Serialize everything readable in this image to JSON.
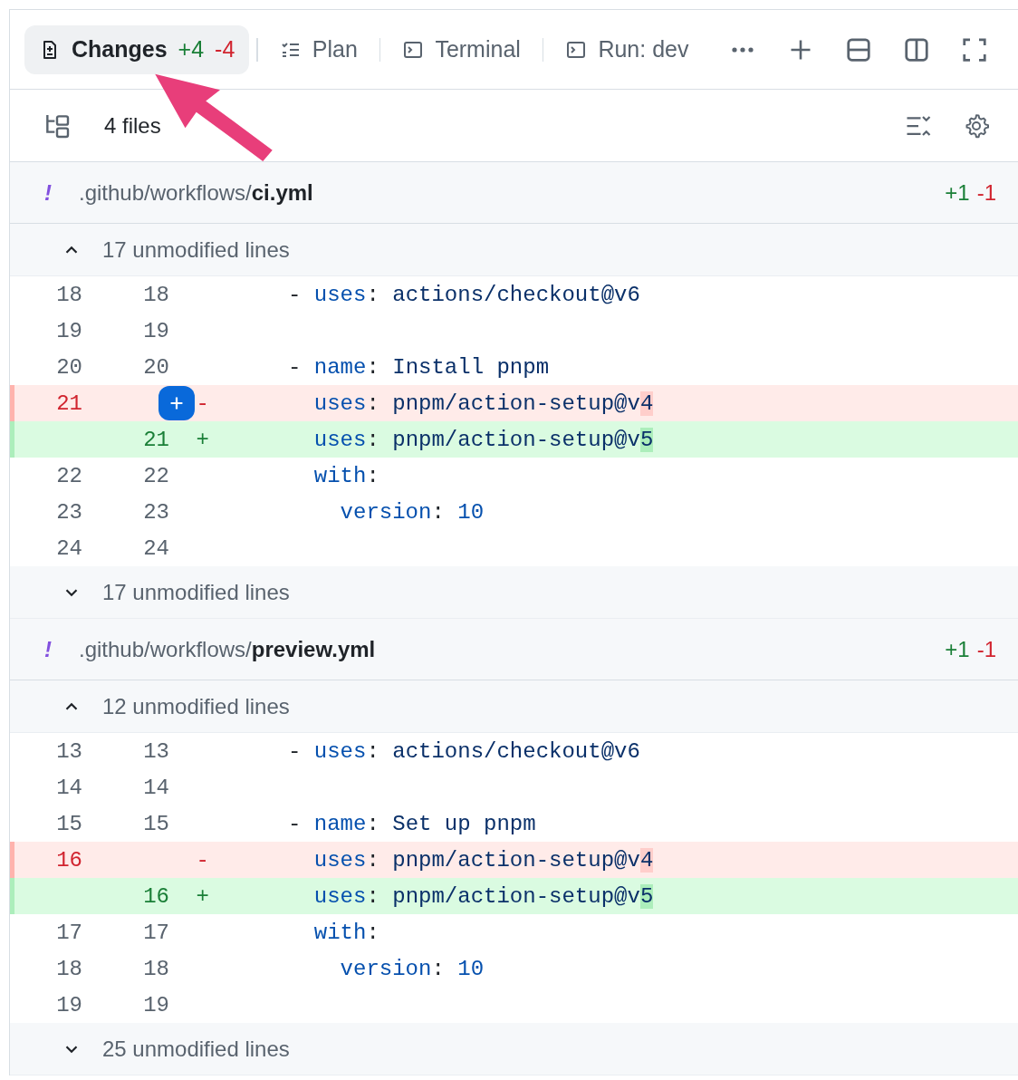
{
  "tabs": [
    {
      "kind": "changes",
      "label": "Changes",
      "added": "+4",
      "removed": "-4",
      "selected": true
    },
    {
      "kind": "plan",
      "label": "Plan",
      "selected": false
    },
    {
      "kind": "terminal",
      "label": "Terminal",
      "selected": false
    },
    {
      "kind": "terminal",
      "label": "Run: dev",
      "selected": false
    }
  ],
  "toolbar": {
    "file_count": "4 files"
  },
  "files": [
    {
      "marker": "!",
      "directory": ".github/workflows/",
      "filename": "ci.yml",
      "added": "+1",
      "removed": "-1",
      "sections": [
        {
          "kind": "collapsed",
          "expanded": false,
          "label": "17 unmodified lines"
        },
        {
          "kind": "lines",
          "lines": [
            {
              "kind": "context",
              "old": "18",
              "new": "18",
              "hover": false,
              "tokens": [
                {
                  "text": "- ",
                  "kind": "punct"
                },
                {
                  "text": "uses",
                  "kind": "key"
                },
                {
                  "text": ": ",
                  "kind": "punct"
                },
                {
                  "text": "actions/checkout@v6",
                  "kind": "value"
                }
              ]
            },
            {
              "kind": "context",
              "old": "19",
              "new": "19",
              "hover": false
            },
            {
              "kind": "context",
              "old": "20",
              "new": "20",
              "hover": false,
              "tokens": [
                {
                  "text": "- ",
                  "kind": "punct"
                },
                {
                  "text": "name",
                  "kind": "key"
                },
                {
                  "text": ": ",
                  "kind": "punct"
                },
                {
                  "text": "Install pnpm",
                  "kind": "value"
                }
              ]
            },
            {
              "kind": "removed",
              "old": "21",
              "sign": "-",
              "hover": true,
              "tokens": [
                {
                  "text": "  uses",
                  "kind": "key"
                },
                {
                  "text": ": ",
                  "kind": "punct"
                },
                {
                  "text": "pnpm/action-setup@v",
                  "kind": "value"
                },
                {
                  "text": "4",
                  "kind": "changed"
                }
              ]
            },
            {
              "kind": "added",
              "new": "21",
              "sign": "+",
              "hover": false,
              "tokens": [
                {
                  "text": "  uses",
                  "kind": "key"
                },
                {
                  "text": ": ",
                  "kind": "punct"
                },
                {
                  "text": "pnpm/action-setup@v",
                  "kind": "value"
                },
                {
                  "text": "5",
                  "kind": "changed"
                }
              ]
            },
            {
              "kind": "context",
              "old": "22",
              "new": "22",
              "hover": false,
              "tokens": [
                {
                  "text": "  with",
                  "kind": "key"
                },
                {
                  "text": ":",
                  "kind": "punct"
                }
              ]
            },
            {
              "kind": "context",
              "old": "23",
              "new": "23",
              "hover": false,
              "tokens": [
                {
                  "text": "    version",
                  "kind": "key"
                },
                {
                  "text": ": ",
                  "kind": "punct"
                },
                {
                  "text": "10",
                  "kind": "number"
                }
              ]
            },
            {
              "kind": "context",
              "old": "24",
              "new": "24",
              "hover": false
            }
          ]
        },
        {
          "kind": "collapsed",
          "expanded": false,
          "label": "17 unmodified lines"
        }
      ]
    },
    {
      "marker": "!",
      "directory": ".github/workflows/",
      "filename": "preview.yml",
      "added": "+1",
      "removed": "-1",
      "sections": [
        {
          "kind": "collapsed",
          "expanded": false,
          "label": "12 unmodified lines"
        },
        {
          "kind": "lines",
          "lines": [
            {
              "kind": "context",
              "old": "13",
              "new": "13",
              "hover": false,
              "tokens": [
                {
                  "text": "- ",
                  "kind": "punct"
                },
                {
                  "text": "uses",
                  "kind": "key"
                },
                {
                  "text": ": ",
                  "kind": "punct"
                },
                {
                  "text": "actions/checkout@v6",
                  "kind": "value"
                }
              ]
            },
            {
              "kind": "context",
              "old": "14",
              "new": "14",
              "hover": false
            },
            {
              "kind": "context",
              "old": "15",
              "new": "15",
              "hover": false,
              "tokens": [
                {
                  "text": "- ",
                  "kind": "punct"
                },
                {
                  "text": "name",
                  "kind": "key"
                },
                {
                  "text": ": ",
                  "kind": "punct"
                },
                {
                  "text": "Set up pnpm",
                  "kind": "value"
                }
              ]
            },
            {
              "kind": "removed",
              "old": "16",
              "sign": "-",
              "hover": false,
              "tokens": [
                {
                  "text": "  uses",
                  "kind": "key"
                },
                {
                  "text": ": ",
                  "kind": "punct"
                },
                {
                  "text": "pnpm/action-setup@v",
                  "kind": "value"
                },
                {
                  "text": "4",
                  "kind": "changed"
                }
              ]
            },
            {
              "kind": "added",
              "new": "16",
              "sign": "+",
              "hover": false,
              "tokens": [
                {
                  "text": "  uses",
                  "kind": "key"
                },
                {
                  "text": ": ",
                  "kind": "punct"
                },
                {
                  "text": "pnpm/action-setup@v",
                  "kind": "value"
                },
                {
                  "text": "5",
                  "kind": "changed"
                }
              ]
            },
            {
              "kind": "context",
              "old": "17",
              "new": "17",
              "hover": false,
              "tokens": [
                {
                  "text": "  with",
                  "kind": "key"
                },
                {
                  "text": ":",
                  "kind": "punct"
                }
              ]
            },
            {
              "kind": "context",
              "old": "18",
              "new": "18",
              "hover": false,
              "tokens": [
                {
                  "text": "    version",
                  "kind": "key"
                },
                {
                  "text": ": ",
                  "kind": "punct"
                },
                {
                  "text": "10",
                  "kind": "number"
                }
              ]
            },
            {
              "kind": "context",
              "old": "19",
              "new": "19",
              "hover": false
            }
          ]
        },
        {
          "kind": "collapsed",
          "expanded": false,
          "label": "25 unmodified lines"
        }
      ]
    }
  ]
}
